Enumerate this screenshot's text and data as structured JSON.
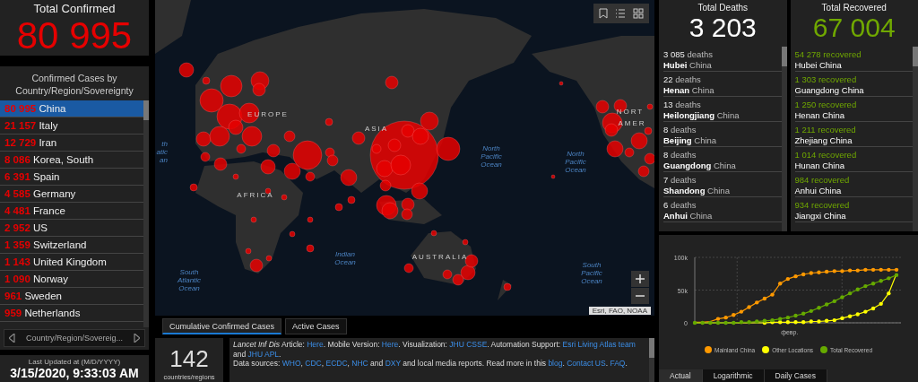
{
  "total_confirmed": {
    "label": "Total Confirmed",
    "value": "80 995"
  },
  "confirmed_list": {
    "title": "Confirmed Cases by Country/Region/Sovereignty",
    "rows": [
      {
        "count": "80 995",
        "name": "China",
        "selected": true
      },
      {
        "count": "21 157",
        "name": "Italy",
        "selected": false
      },
      {
        "count": "12 729",
        "name": "Iran",
        "selected": false
      },
      {
        "count": "8 086",
        "name": "Korea, South",
        "selected": false
      },
      {
        "count": "6 391",
        "name": "Spain",
        "selected": false
      },
      {
        "count": "4 585",
        "name": "Germany",
        "selected": false
      },
      {
        "count": "4 481",
        "name": "France",
        "selected": false
      },
      {
        "count": "2 952",
        "name": "US",
        "selected": false
      },
      {
        "count": "1 359",
        "name": "Switzerland",
        "selected": false
      },
      {
        "count": "1 143",
        "name": "United Kingdom",
        "selected": false
      },
      {
        "count": "1 090",
        "name": "Norway",
        "selected": false
      },
      {
        "count": "961",
        "name": "Sweden",
        "selected": false
      },
      {
        "count": "959",
        "name": "Netherlands",
        "selected": false
      }
    ],
    "footer": "Country/Region/Sovereig..."
  },
  "last_updated": {
    "label": "Last Updated at (M/D/YYYY)",
    "value": "3/15/2020, 9:33:03 AM"
  },
  "map": {
    "labels": [
      {
        "kind": "region",
        "text": "EUROPE"
      },
      {
        "kind": "region",
        "text": "ASIA"
      },
      {
        "kind": "region",
        "text": "AFRICA"
      },
      {
        "kind": "region",
        "text": "AUSTRALIA"
      },
      {
        "kind": "region",
        "text": "NORT"
      },
      {
        "kind": "region",
        "text": "AMER"
      },
      {
        "kind": "ocean",
        "text": "th\natic\nan"
      },
      {
        "kind": "ocean",
        "text": "North\nPacific\nOcean"
      },
      {
        "kind": "ocean",
        "text": "North\nPacific\nOcean"
      },
      {
        "kind": "ocean",
        "text": "Indian\nOcean"
      },
      {
        "kind": "ocean",
        "text": "South\nAtlantic\nOcean"
      },
      {
        "kind": "ocean",
        "text": "South\nPacific\nOcean"
      }
    ],
    "attribution": "Esri, FAO, NOAA"
  },
  "map_tabs": [
    {
      "label": "Cumulative Confirmed Cases",
      "selected": true
    },
    {
      "label": "Active Cases",
      "selected": false
    }
  ],
  "countries": {
    "value": "142",
    "label": "countries/regions"
  },
  "info": {
    "lines": [
      [
        {
          "text": "*Lancet Inf Dis* Article: ",
          "kind": "text"
        },
        {
          "text": "Here",
          "kind": "link"
        },
        {
          "text": ". Mobile Version: ",
          "kind": "text"
        },
        {
          "text": "Here",
          "kind": "link"
        },
        {
          "text": ". Visualization: ",
          "kind": "text"
        },
        {
          "text": "JHU CSSE",
          "kind": "link"
        },
        {
          "text": ". Automation Support: ",
          "kind": "text"
        },
        {
          "text": "Esri Living Atlas team",
          "kind": "link"
        },
        {
          "text": " and ",
          "kind": "text"
        },
        {
          "text": "JHU APL",
          "kind": "link"
        },
        {
          "text": ".",
          "kind": "text"
        }
      ],
      [
        {
          "text": "Data sources: ",
          "kind": "text"
        },
        {
          "text": "WHO",
          "kind": "link"
        },
        {
          "text": ", ",
          "kind": "text"
        },
        {
          "text": "CDC",
          "kind": "link"
        },
        {
          "text": ", ",
          "kind": "text"
        },
        {
          "text": "ECDC",
          "kind": "link"
        },
        {
          "text": ", ",
          "kind": "text"
        },
        {
          "text": "NHC",
          "kind": "link"
        },
        {
          "text": " and ",
          "kind": "text"
        },
        {
          "text": "DXY",
          "kind": "link"
        },
        {
          "text": " and local media reports. Read more in this ",
          "kind": "text"
        },
        {
          "text": "blog",
          "kind": "link"
        },
        {
          "text": ". ",
          "kind": "text"
        },
        {
          "text": "Contact US",
          "kind": "link"
        },
        {
          "text": ". ",
          "kind": "text"
        },
        {
          "text": "FAQ",
          "kind": "link"
        },
        {
          "text": ".",
          "kind": "text"
        }
      ]
    ]
  },
  "deaths": {
    "label": "Total Deaths",
    "value": "3 203",
    "items": [
      {
        "count": "3 085",
        "unit": "deaths",
        "place": "Hubei",
        "country": "China"
      },
      {
        "count": "22",
        "unit": "deaths",
        "place": "Henan",
        "country": "China"
      },
      {
        "count": "13",
        "unit": "deaths",
        "place": "Heilongjiang",
        "country": "China"
      },
      {
        "count": "8",
        "unit": "deaths",
        "place": "Beijing",
        "country": "China"
      },
      {
        "count": "8",
        "unit": "deaths",
        "place": "Guangdong",
        "country": "China"
      },
      {
        "count": "7",
        "unit": "deaths",
        "place": "Shandong",
        "country": "China"
      },
      {
        "count": "6",
        "unit": "deaths",
        "place": "Anhui",
        "country": "China"
      }
    ]
  },
  "recovered": {
    "label": "Total Recovered",
    "value": "67 004",
    "items": [
      {
        "count": "54 278",
        "unit": "recovered",
        "place": "Hubei",
        "country": "China"
      },
      {
        "count": "1 303",
        "unit": "recovered",
        "place": "Guangdong",
        "country": "China"
      },
      {
        "count": "1 250",
        "unit": "recovered",
        "place": "Henan",
        "country": "China"
      },
      {
        "count": "1 211",
        "unit": "recovered",
        "place": "Zhejiang",
        "country": "China"
      },
      {
        "count": "1 014",
        "unit": "recovered",
        "place": "Hunan",
        "country": "China"
      },
      {
        "count": "984",
        "unit": "recovered",
        "place": "Anhui",
        "country": "China"
      },
      {
        "count": "934",
        "unit": "recovered",
        "place": "Jiangxi",
        "country": "China"
      }
    ]
  },
  "chart": {
    "chart_data": {
      "type": "line",
      "ylim": [
        0,
        100000
      ],
      "annotations": [
        {
          "text": "февр."
        }
      ],
      "yticks": [
        {
          "value": 0,
          "label": "0"
        },
        {
          "value": 50000,
          "label": "50k"
        },
        {
          "value": 100000,
          "label": "100k"
        }
      ],
      "series": [
        {
          "name": "Mainland China",
          "color": "#ff9900",
          "values": [
            1000,
            1000,
            2000,
            6000,
            8000,
            12000,
            17000,
            24000,
            31000,
            37000,
            43000,
            60000,
            67000,
            71000,
            74000,
            76000,
            77000,
            78000,
            79000,
            79000,
            80000,
            80000,
            81000,
            81000,
            81000,
            81000,
            81000
          ]
        },
        {
          "name": "Other Locations",
          "color": "#ffff00",
          "values": [
            0,
            0,
            0,
            0,
            0,
            0,
            0,
            0,
            0,
            0,
            1000,
            1000,
            1000,
            1000,
            1000,
            2000,
            2000,
            3000,
            4000,
            7000,
            10000,
            13000,
            17000,
            22000,
            29000,
            45000,
            75000
          ]
        },
        {
          "name": "Total Recovered",
          "color": "#66aa00",
          "values": [
            0,
            0,
            0,
            0,
            0,
            0,
            1000,
            1000,
            2000,
            3000,
            4000,
            6000,
            8000,
            11000,
            14000,
            18000,
            23000,
            28000,
            33000,
            39000,
            45000,
            51000,
            56000,
            60000,
            64000,
            68000,
            73000
          ]
        }
      ]
    }
  },
  "chart_tabs": [
    {
      "label": "Actual",
      "selected": true
    },
    {
      "label": "Logarithmic",
      "selected": false
    },
    {
      "label": "Daily Cases",
      "selected": false
    }
  ]
}
